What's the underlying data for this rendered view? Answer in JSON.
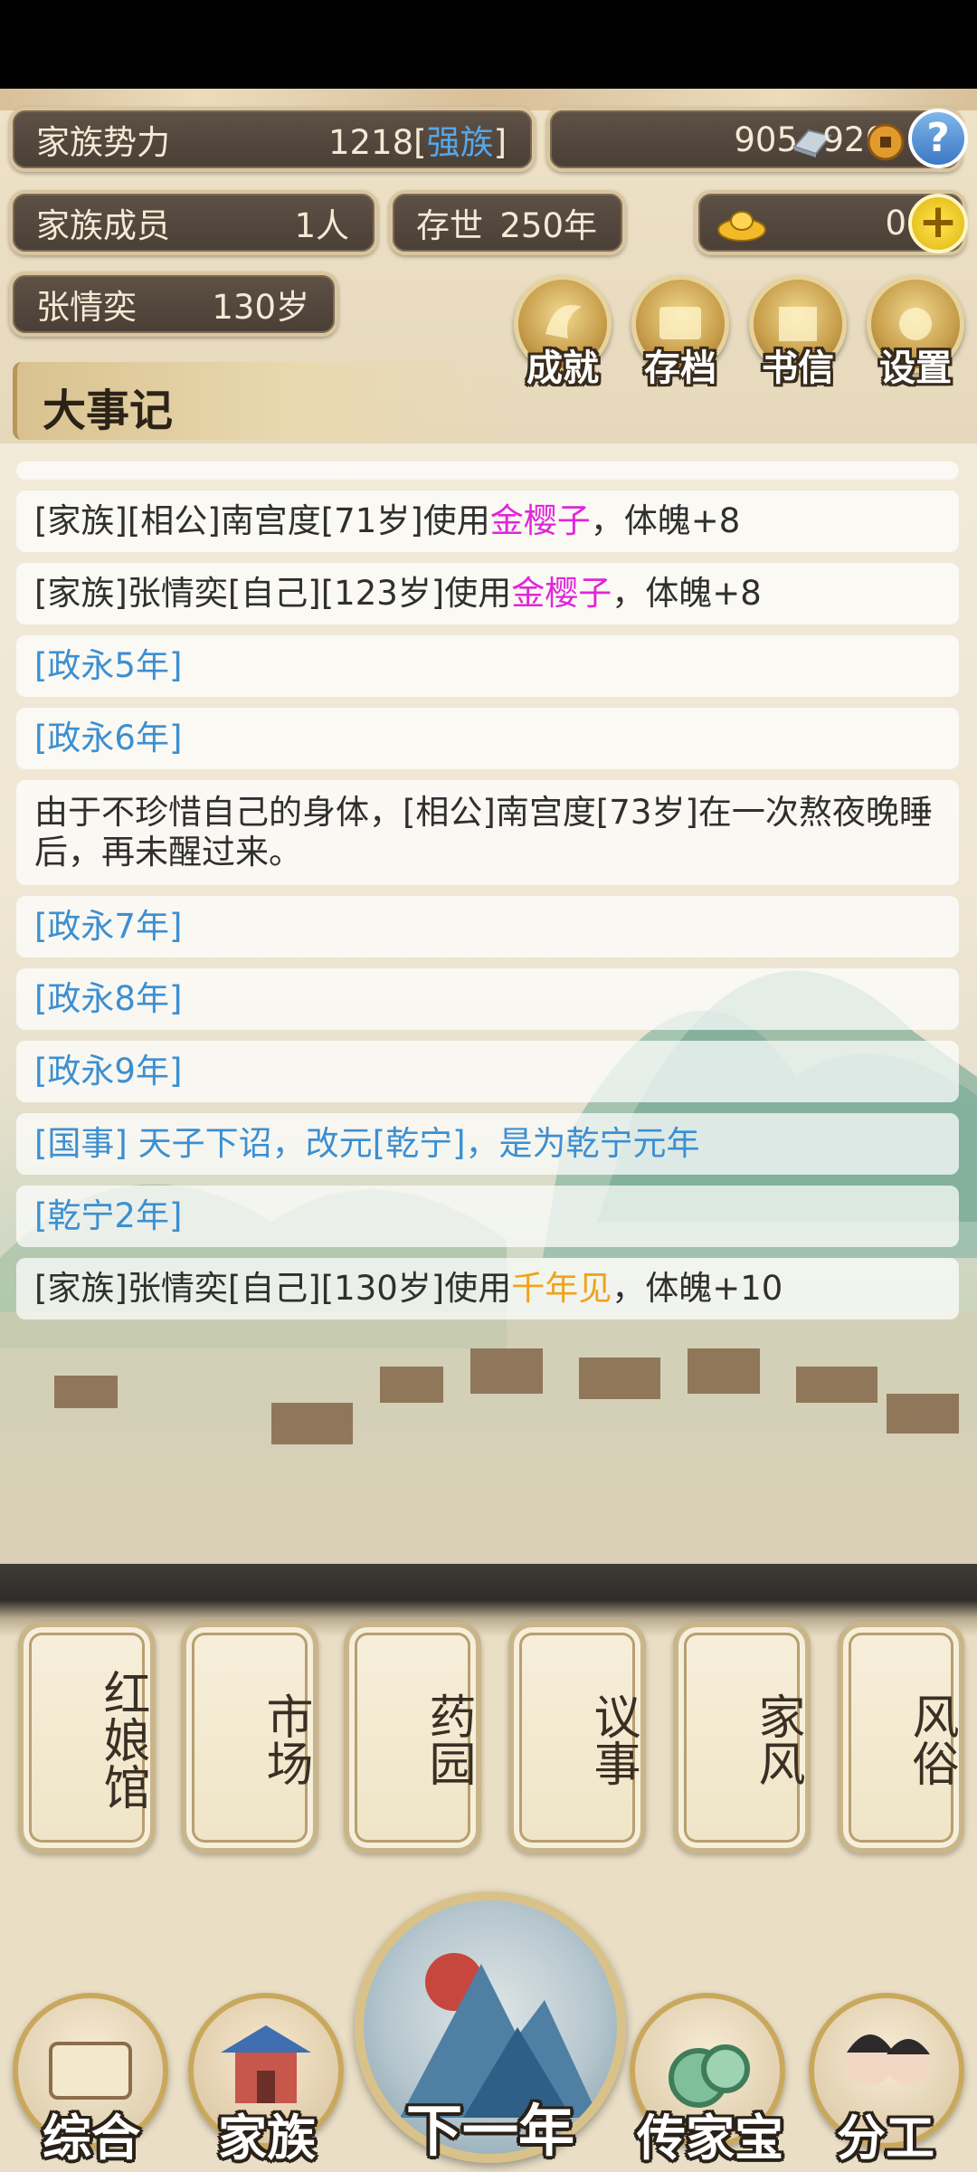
{
  "stats": {
    "power_label": "家族势力",
    "power_value": "1218",
    "power_rank": "强族",
    "silver": "905",
    "copper": "920",
    "members_label": "家族成员",
    "members_value": "1人",
    "existence_label": "存世",
    "existence_value": "250年",
    "gold": "0",
    "leader_name": "张情奕",
    "leader_age": "130岁"
  },
  "menu": {
    "achievements": "成就",
    "save": "存档",
    "letters": "书信",
    "settings": "设置"
  },
  "chronicle_title": "大事记",
  "log": [
    {
      "pre": "[家族][相公]南宫度[71岁]使用",
      "item": "金樱子",
      "post": "，体魄+8"
    },
    {
      "pre": "[家族]张情奕[自己][123岁]使用",
      "item": "金樱子",
      "post": "，体魄+8"
    },
    {
      "year": "[政永5年]"
    },
    {
      "year": "[政永6年]"
    },
    {
      "text": "由于不珍惜自己的身体，[相公]南宫度[73岁]在一次熬夜晚睡后，再未醒过来。"
    },
    {
      "year": "[政永7年]"
    },
    {
      "year": "[政永8年]"
    },
    {
      "year": "[政永9年]"
    },
    {
      "year": "[国事] 天子下诏，改元[乾宁]，是为乾宁元年"
    },
    {
      "year": "[乾宁2年]"
    },
    {
      "pre": "[家族]张情奕[自己][130岁]使用",
      "item": "千年见",
      "post": "，体魄+10"
    }
  ],
  "buildings": [
    "红娘馆",
    "市场",
    "药园",
    "议事",
    "家风",
    "风俗"
  ],
  "nav": {
    "overview": "综合",
    "family": "家族",
    "next_year": "下一年",
    "heirloom": "传家宝",
    "division": "分工"
  },
  "colors": {
    "year_blue": "#3c8fd1",
    "item_magenta": "#e026d8",
    "item_orange": "#f1a21a",
    "rank_blue": "#56a7e8"
  },
  "icons": [
    "silver-ingot-icon",
    "copper-coin-icon",
    "help-icon",
    "gold-ingot-icon",
    "add-icon"
  ]
}
